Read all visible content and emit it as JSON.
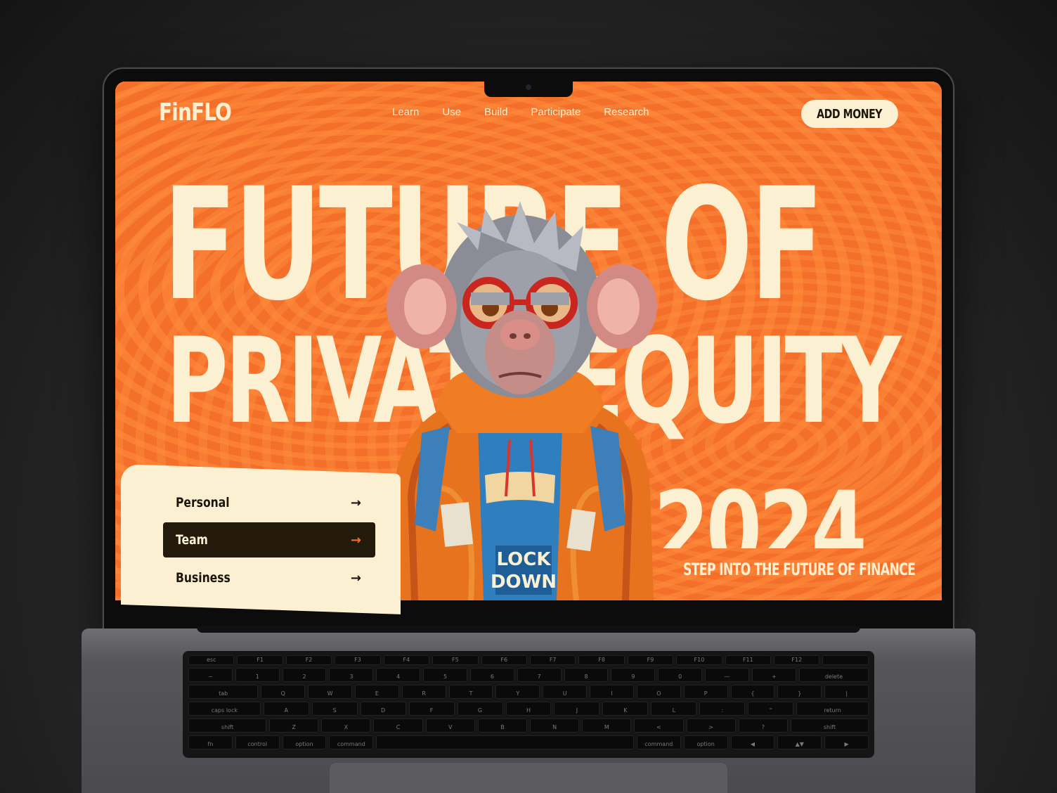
{
  "site": {
    "logo": "FinFLO",
    "nav": [
      "Learn",
      "Use",
      "Build",
      "Participate",
      "Research"
    ],
    "cta_label": "ADD MONEY"
  },
  "hero": {
    "line1": "FUTURE OF",
    "line2": "PRIVATE EQUITY",
    "line3": "2024",
    "tagline": "STEP INTO THE FUTURE OF FINANCE",
    "mascot_shirt_text_1": "LOCK",
    "mascot_shirt_text_2": "DOWN"
  },
  "menu": {
    "items": [
      {
        "label": "Personal",
        "arrow": "→"
      },
      {
        "label": "Team",
        "arrow": "→"
      },
      {
        "label": "Business",
        "arrow": "→"
      }
    ],
    "active_index": 1
  },
  "keyboard": {
    "rows": [
      [
        "esc",
        "F1",
        "F2",
        "F3",
        "F4",
        "F5",
        "F6",
        "F7",
        "F8",
        "F9",
        "F10",
        "F11",
        "F12",
        ""
      ],
      [
        "~",
        "1",
        "2",
        "3",
        "4",
        "5",
        "6",
        "7",
        "8",
        "9",
        "0",
        "—",
        "+",
        "delete"
      ],
      [
        "tab",
        "Q",
        "W",
        "E",
        "R",
        "T",
        "Y",
        "U",
        "I",
        "O",
        "P",
        "{",
        "}",
        "|"
      ],
      [
        "caps lock",
        "A",
        "S",
        "D",
        "F",
        "G",
        "H",
        "J",
        "K",
        "L",
        ":",
        "\"",
        "return"
      ],
      [
        "shift",
        "Z",
        "X",
        "C",
        "V",
        "B",
        "N",
        "M",
        "<",
        ">",
        "?",
        "shift"
      ],
      [
        "fn",
        "control",
        "option",
        "command",
        "",
        "command",
        "option",
        "◀",
        "▲▼",
        "▶"
      ]
    ]
  },
  "colors": {
    "brand_orange": "#f4702a",
    "cream": "#fbf1d2",
    "dark": "#231a0b"
  }
}
